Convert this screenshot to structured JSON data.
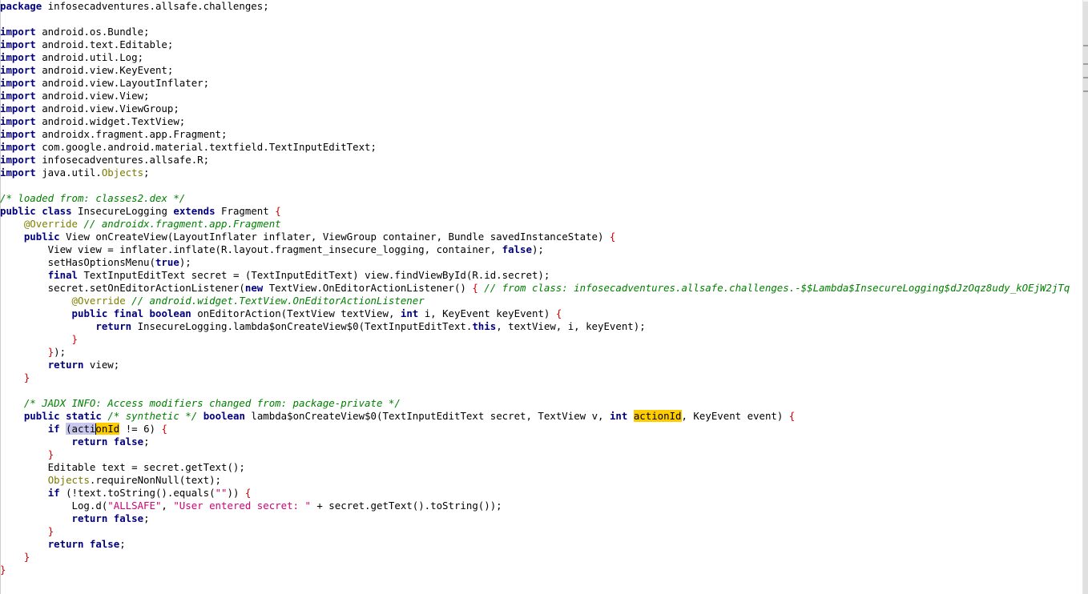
{
  "editor": {
    "lines": [
      [
        [
          "package",
          "kw"
        ],
        [
          " infosecadventures.allsafe.challenges;",
          ""
        ]
      ],
      [],
      [
        [
          "import",
          "kw"
        ],
        [
          " android.os.Bundle;",
          ""
        ]
      ],
      [
        [
          "import",
          "kw"
        ],
        [
          " android.text.Editable;",
          ""
        ]
      ],
      [
        [
          "import",
          "kw"
        ],
        [
          " android.util.Log;",
          ""
        ]
      ],
      [
        [
          "import",
          "kw"
        ],
        [
          " android.view.KeyEvent;",
          ""
        ]
      ],
      [
        [
          "import",
          "kw"
        ],
        [
          " android.view.LayoutInflater;",
          ""
        ]
      ],
      [
        [
          "import",
          "kw"
        ],
        [
          " android.view.View;",
          ""
        ]
      ],
      [
        [
          "import",
          "kw"
        ],
        [
          " android.view.ViewGroup;",
          ""
        ]
      ],
      [
        [
          "import",
          "kw"
        ],
        [
          " android.widget.TextView;",
          ""
        ]
      ],
      [
        [
          "import",
          "kw"
        ],
        [
          " androidx.fragment.app.Fragment;",
          ""
        ]
      ],
      [
        [
          "import",
          "kw"
        ],
        [
          " com.google.android.material.textfield.TextInputEditText;",
          ""
        ]
      ],
      [
        [
          "import",
          "kw"
        ],
        [
          " infosecadventures.allsafe.R;",
          ""
        ]
      ],
      [
        [
          "import",
          "kw"
        ],
        [
          " java.util.",
          ""
        ],
        [
          "Objects",
          "cl"
        ],
        [
          ";",
          ""
        ]
      ],
      [],
      [
        [
          "/* loaded from: classes2.dex */",
          "cm"
        ]
      ],
      [
        [
          "public",
          "kw"
        ],
        [
          " ",
          ""
        ],
        [
          "class",
          "kw"
        ],
        [
          " InsecureLogging ",
          ""
        ],
        [
          "extends",
          "kw"
        ],
        [
          " Fragment ",
          ""
        ],
        [
          "{",
          "br"
        ]
      ],
      [
        [
          "    ",
          ""
        ],
        [
          "@Override",
          "an"
        ],
        [
          " ",
          ""
        ],
        [
          "// androidx.fragment.app.Fragment",
          "cm"
        ]
      ],
      [
        [
          "    ",
          ""
        ],
        [
          "public",
          "kw"
        ],
        [
          " View onCreateView(LayoutInflater inflater, ViewGroup container, Bundle savedInstanceState) ",
          ""
        ],
        [
          "{",
          "br"
        ]
      ],
      [
        [
          "        View view = inflater.inflate(R.layout.fragment_insecure_logging, container, ",
          ""
        ],
        [
          "false",
          "kw"
        ],
        [
          ");",
          ""
        ]
      ],
      [
        [
          "        setHasOptionsMenu(",
          ""
        ],
        [
          "true",
          "kw"
        ],
        [
          ");",
          ""
        ]
      ],
      [
        [
          "        ",
          ""
        ],
        [
          "final",
          "kw"
        ],
        [
          " TextInputEditText secret = (TextInputEditText) view.findViewById(R.id.secret);",
          ""
        ]
      ],
      [
        [
          "        secret.setOnEditorActionListener(",
          ""
        ],
        [
          "new",
          "kw"
        ],
        [
          " TextView.OnEditorActionListener() ",
          ""
        ],
        [
          "{",
          "br"
        ],
        [
          " ",
          ""
        ],
        [
          "// from class: infosecadventures.allsafe.challenges.-$$Lambda$InsecureLogging$dJzOqz8udy_kOEjW2jTq",
          "cm"
        ]
      ],
      [
        [
          "            ",
          ""
        ],
        [
          "@Override",
          "an"
        ],
        [
          " ",
          ""
        ],
        [
          "// android.widget.TextView.OnEditorActionListener",
          "cm"
        ]
      ],
      [
        [
          "            ",
          ""
        ],
        [
          "public",
          "kw"
        ],
        [
          " ",
          ""
        ],
        [
          "final",
          "kw"
        ],
        [
          " ",
          ""
        ],
        [
          "boolean",
          "kw"
        ],
        [
          " onEditorAction(TextView textView, ",
          ""
        ],
        [
          "int",
          "kw"
        ],
        [
          " i, KeyEvent keyEvent) ",
          ""
        ],
        [
          "{",
          "br"
        ]
      ],
      [
        [
          "                ",
          ""
        ],
        [
          "return",
          "kw"
        ],
        [
          " InsecureLogging.lambda$onCreateView$0(TextInputEditText.",
          ""
        ],
        [
          "this",
          "kw"
        ],
        [
          ", textView, i, keyEvent);",
          ""
        ]
      ],
      [
        [
          "            ",
          ""
        ],
        [
          "}",
          "br"
        ]
      ],
      [
        [
          "        ",
          ""
        ],
        [
          "}",
          "br"
        ],
        [
          ");",
          ""
        ]
      ],
      [
        [
          "        ",
          ""
        ],
        [
          "return",
          "kw"
        ],
        [
          " view;",
          ""
        ]
      ],
      [
        [
          "    ",
          ""
        ],
        [
          "}",
          "br"
        ]
      ],
      [],
      [
        [
          "    ",
          ""
        ],
        [
          "/* JADX INFO: Access modifiers changed from: package-private */",
          "cm"
        ]
      ],
      [
        [
          "    ",
          ""
        ],
        [
          "public",
          "kw"
        ],
        [
          " ",
          ""
        ],
        [
          "static",
          "kw"
        ],
        [
          " ",
          ""
        ],
        [
          "/* synthetic */",
          "cm"
        ],
        [
          " ",
          ""
        ],
        [
          "boolean",
          "kw"
        ],
        [
          " lambda$onCreateView$0(TextInputEditText secret, TextView v, ",
          ""
        ],
        [
          "int",
          "kw"
        ],
        [
          " ",
          ""
        ],
        [
          "actionId",
          "hl"
        ],
        [
          ", KeyEvent event) ",
          ""
        ],
        [
          "{",
          "br"
        ]
      ],
      [
        [
          "        ",
          ""
        ],
        [
          "if",
          "kw"
        ],
        [
          " ",
          ""
        ],
        [
          "(acti",
          "hlb"
        ],
        [
          "onId",
          "hl"
        ],
        [
          " != 6) ",
          ""
        ],
        [
          "{",
          "br"
        ]
      ],
      [
        [
          "            ",
          ""
        ],
        [
          "return",
          "kw"
        ],
        [
          " ",
          ""
        ],
        [
          "false",
          "kw"
        ],
        [
          ";",
          ""
        ]
      ],
      [
        [
          "        ",
          ""
        ],
        [
          "}",
          "br"
        ]
      ],
      [
        [
          "        Editable text = secret.getText();",
          ""
        ]
      ],
      [
        [
          "        ",
          ""
        ],
        [
          "Objects",
          "cl"
        ],
        [
          ".requireNonNull(text);",
          ""
        ]
      ],
      [
        [
          "        ",
          ""
        ],
        [
          "if",
          "kw"
        ],
        [
          " (!text.toString().equals(",
          ""
        ],
        [
          "\"\"",
          "st"
        ],
        [
          ")) ",
          ""
        ],
        [
          "{",
          "br"
        ]
      ],
      [
        [
          "            Log.d(",
          ""
        ],
        [
          "\"ALLSAFE\"",
          "st"
        ],
        [
          ", ",
          ""
        ],
        [
          "\"User entered secret: \"",
          "st"
        ],
        [
          " + secret.getText().toString());",
          ""
        ]
      ],
      [
        [
          "            ",
          ""
        ],
        [
          "return",
          "kw"
        ],
        [
          " ",
          ""
        ],
        [
          "false",
          "kw"
        ],
        [
          ";",
          ""
        ]
      ],
      [
        [
          "        ",
          ""
        ],
        [
          "}",
          "br"
        ]
      ],
      [
        [
          "        ",
          ""
        ],
        [
          "return",
          "kw"
        ],
        [
          " ",
          ""
        ],
        [
          "false",
          "kw"
        ],
        [
          ";",
          ""
        ]
      ],
      [
        [
          "    ",
          ""
        ],
        [
          "}",
          "br"
        ]
      ],
      [
        [
          "}",
          "br"
        ]
      ]
    ]
  }
}
